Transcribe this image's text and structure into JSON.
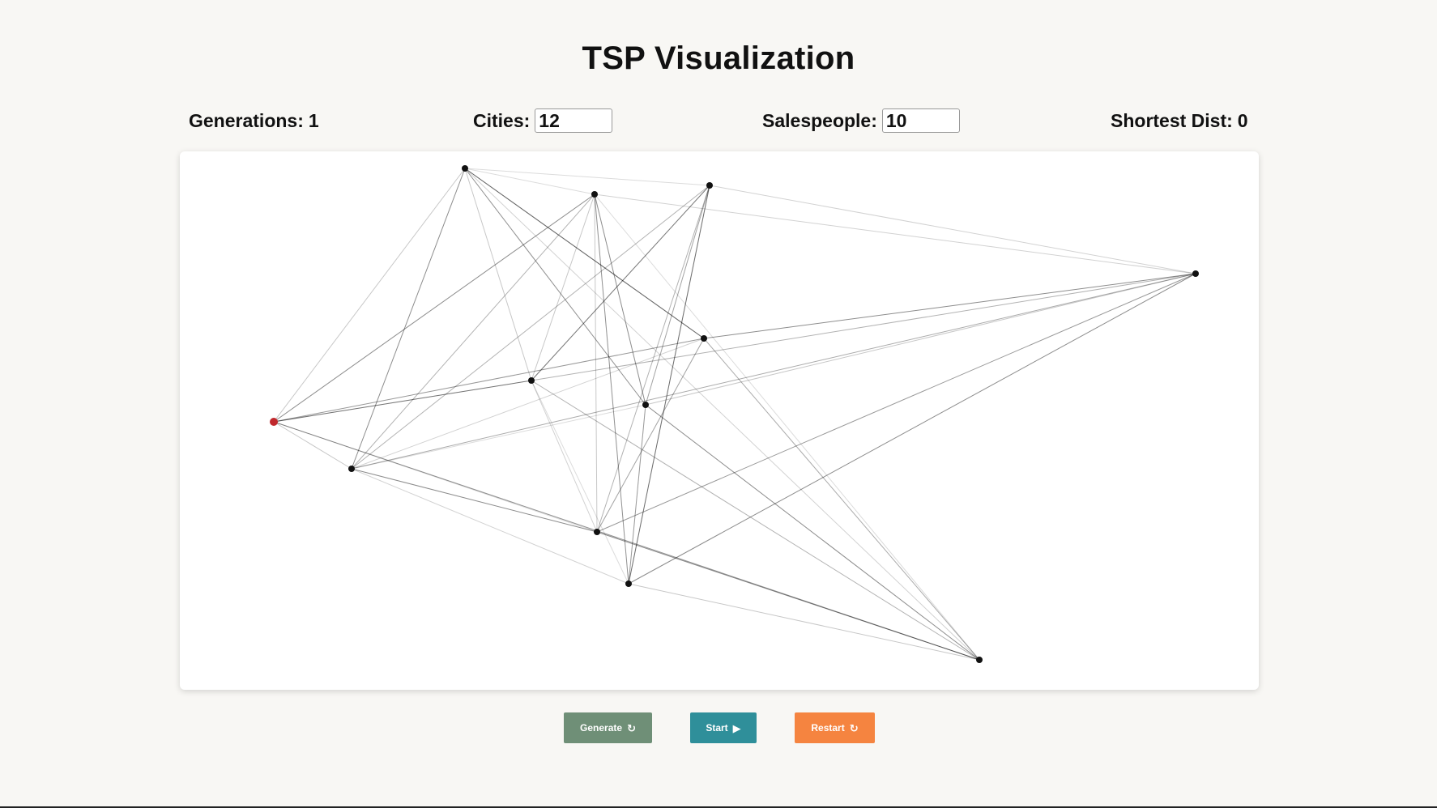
{
  "header": {
    "title": "TSP Visualization"
  },
  "stats": {
    "generations_label": "Generations:",
    "generations_value": "1",
    "cities_label": "Cities:",
    "cities_value": "12",
    "salespeople_label": "Salespeople:",
    "salespeople_value": "10",
    "shortest_label": "Shortest Dist:",
    "shortest_value": "0"
  },
  "buttons": {
    "generate_label": "Generate",
    "start_label": "Start",
    "restart_label": "Restart"
  },
  "colors": {
    "generate": "#6f8f77",
    "start": "#2f8f9a",
    "restart": "#f58440",
    "start_city": "#c0282d",
    "city": "#111111"
  },
  "icons": {
    "generate": "refresh-icon",
    "start": "play-icon",
    "restart": "restart-icon"
  }
}
